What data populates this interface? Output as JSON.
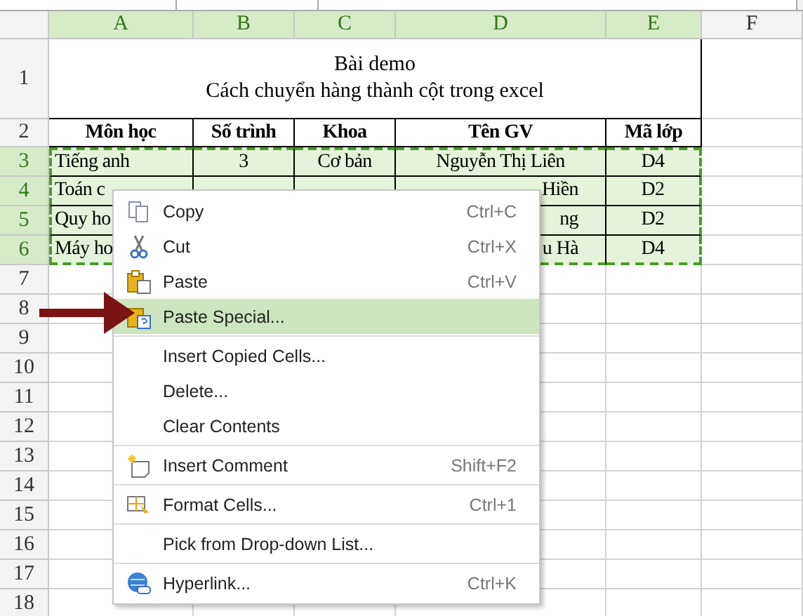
{
  "sheet": {
    "columns": [
      {
        "label": "A",
        "selected": true
      },
      {
        "label": "B",
        "selected": true
      },
      {
        "label": "C",
        "selected": true
      },
      {
        "label": "D",
        "selected": true
      },
      {
        "label": "E",
        "selected": true
      },
      {
        "label": "F",
        "selected": false
      }
    ],
    "title_lines": [
      "Bài demo",
      "Cách chuyển hàng thành cột trong excel"
    ],
    "header_cells": [
      "Môn học",
      "Số trình",
      "Khoa",
      "Tên GV",
      "Mã lớp"
    ],
    "rows": [
      {
        "number": "1",
        "selected": false
      },
      {
        "number": "2",
        "selected": false
      },
      {
        "number": "3",
        "selected": true,
        "cells": [
          {
            "text": "Tiếng anh",
            "kind": "full"
          },
          {
            "text": "3",
            "kind": "full"
          },
          {
            "text": "Cơ bản",
            "kind": "full"
          },
          {
            "text": "Nguyễn Thị Liên",
            "kind": "full"
          },
          {
            "text": "D4",
            "kind": "full"
          }
        ]
      },
      {
        "number": "4",
        "selected": true,
        "cells": [
          {
            "text": "Toán c",
            "kind": "full"
          },
          null,
          null,
          {
            "text": "Hiền",
            "kind": "partial"
          },
          {
            "text": "D2",
            "kind": "full"
          }
        ]
      },
      {
        "number": "5",
        "selected": true,
        "cells": [
          {
            "text": "Quy ho",
            "kind": "full"
          },
          null,
          null,
          {
            "text": "ng",
            "kind": "partial"
          },
          {
            "text": "D2",
            "kind": "full"
          }
        ]
      },
      {
        "number": "6",
        "selected": true,
        "cells": [
          {
            "text": "Máy ho",
            "kind": "full"
          },
          null,
          null,
          {
            "text": "u Hà",
            "kind": "partial"
          },
          {
            "text": "D4",
            "kind": "full"
          }
        ]
      },
      {
        "number": "7",
        "selected": false
      },
      {
        "number": "8",
        "selected": false
      },
      {
        "number": "9",
        "selected": false
      },
      {
        "number": "10",
        "selected": false
      },
      {
        "number": "11",
        "selected": false
      },
      {
        "number": "12",
        "selected": false
      },
      {
        "number": "13",
        "selected": false
      },
      {
        "number": "14",
        "selected": false
      },
      {
        "number": "15",
        "selected": false
      },
      {
        "number": "16",
        "selected": false
      },
      {
        "number": "17",
        "selected": false
      },
      {
        "number": "18",
        "selected": false
      }
    ]
  },
  "context_menu": {
    "items": [
      {
        "label": "Copy",
        "shortcut": "Ctrl+C",
        "kind": "copy",
        "selected": false,
        "separator_before": false
      },
      {
        "label": "Cut",
        "shortcut": "Ctrl+X",
        "kind": "cut",
        "selected": false,
        "separator_before": false
      },
      {
        "label": "Paste",
        "shortcut": "Ctrl+V",
        "kind": "paste",
        "selected": false,
        "separator_before": false
      },
      {
        "label": "Paste Special...",
        "kind": "paste-special",
        "selected": true,
        "separator_before": false
      },
      {
        "label": "Insert Copied Cells...",
        "kind": "plain",
        "selected": false,
        "separator_before": true
      },
      {
        "label": "Delete...",
        "kind": "plain",
        "selected": false,
        "separator_before": false
      },
      {
        "label": "Clear Contents",
        "kind": "plain",
        "selected": false,
        "separator_before": false
      },
      {
        "label": "Insert Comment",
        "shortcut": "Shift+F2",
        "kind": "comment",
        "selected": false,
        "separator_before": true
      },
      {
        "label": "Format Cells...",
        "shortcut": "Ctrl+1",
        "kind": "format",
        "selected": false,
        "separator_before": true
      },
      {
        "label": "Pick from Drop-down List...",
        "kind": "plain",
        "selected": false,
        "separator_before": true
      },
      {
        "label": "Hyperlink...",
        "shortcut": "Ctrl+K",
        "kind": "hyperlink",
        "selected": false,
        "separator_before": true
      }
    ]
  }
}
